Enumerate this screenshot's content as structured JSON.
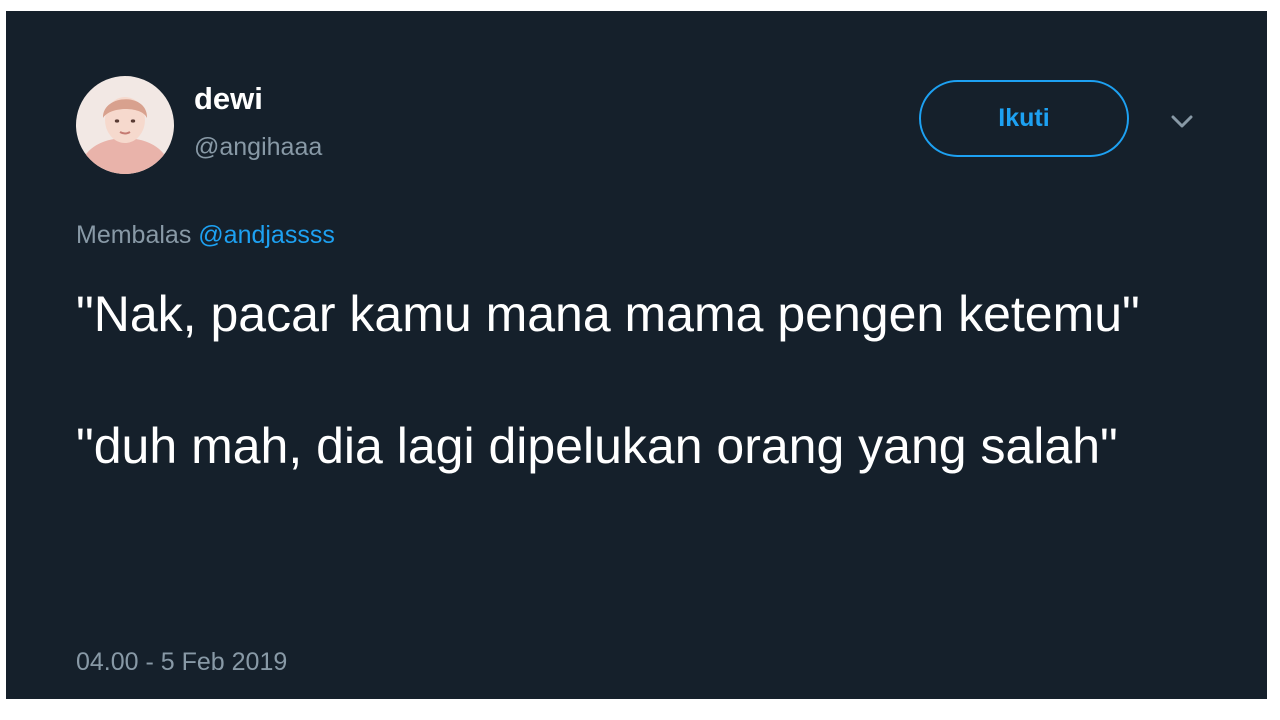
{
  "tweet": {
    "author": {
      "display_name": "dewi",
      "handle": "@angihaaa"
    },
    "follow_label": "Ikuti",
    "reply_prefix": "Membalas",
    "reply_to": "@andjassss",
    "text_paragraphs": [
      "\"Nak, pacar kamu mana mama pengen ketemu\"",
      "\"duh mah, dia lagi dipelukan orang yang salah\""
    ],
    "timestamp": "04.00 - 5 Feb 2019"
  },
  "theme": {
    "background": "#15202b",
    "text": "#ffffff",
    "secondary_text": "#8899a6",
    "accent": "#1da1f2"
  },
  "icons": {
    "avatar": "user-avatar-photo",
    "more_menu": "chevron-down-icon"
  }
}
